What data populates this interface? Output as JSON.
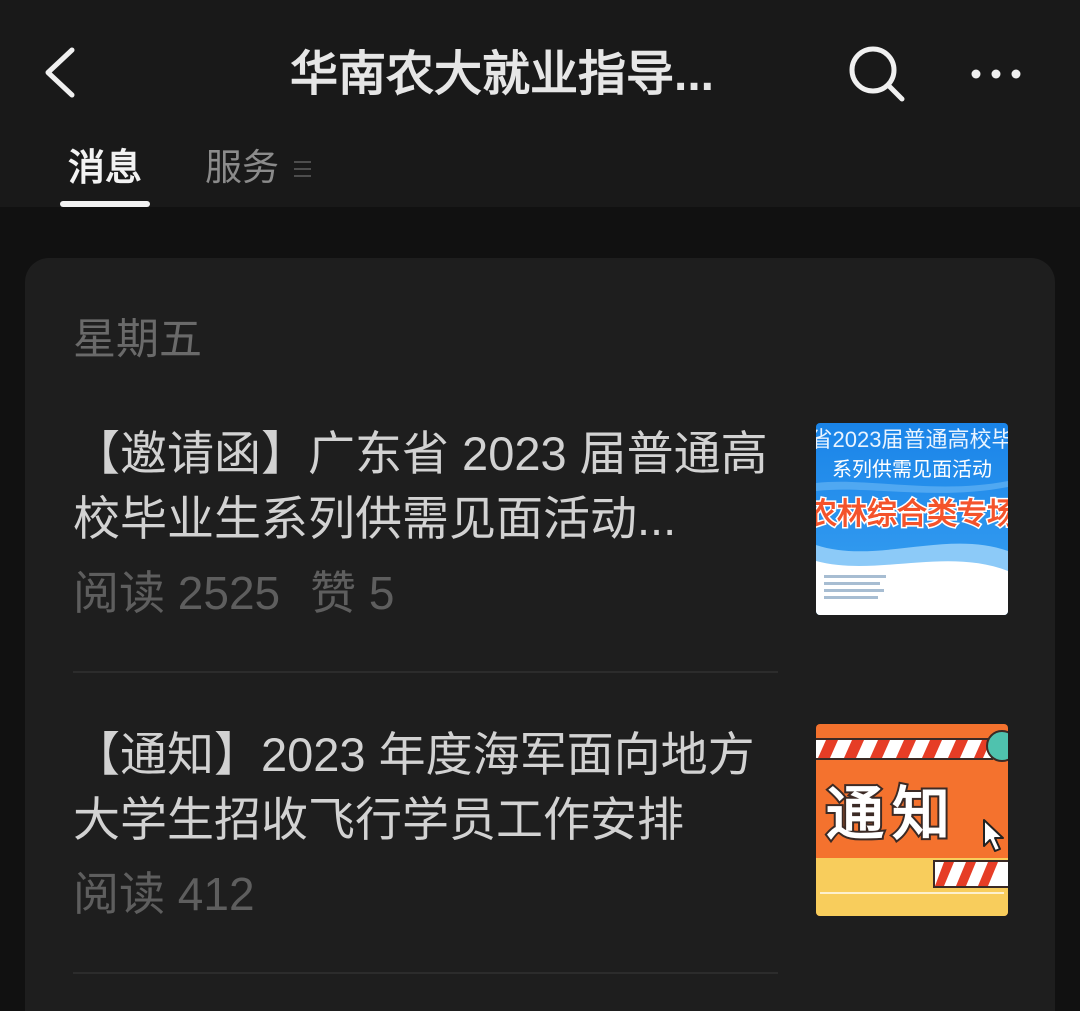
{
  "colors": {
    "page_bg": "#111111",
    "header_bg": "#191919",
    "card_bg": "#1e1e1e",
    "primary_text": "#d2d2d2",
    "secondary_text": "#5e5e5e",
    "divider": "#2c2c2c",
    "tab_active": "#f2f2f2",
    "tab_inactive": "#8b8b8b"
  },
  "header": {
    "back_icon": "chevron-left-icon",
    "title": "华南农大就业指导...",
    "search_icon": "search-icon",
    "more_icon": "more-horizontal-icon"
  },
  "tabs": [
    {
      "label": "消息",
      "active": true
    },
    {
      "label": "服务",
      "active": false,
      "icon": "menu-icon"
    }
  ],
  "feed": {
    "date_label": "星期五",
    "articles": [
      {
        "title": "【邀请函】广东省 2023 届普通高校毕业生系列供需见面活动...",
        "stats": [
          {
            "label": "阅读",
            "value": "2525"
          },
          {
            "label": "赞",
            "value": "5"
          }
        ],
        "thumbnail": {
          "dominant_color": "#1a84e8",
          "lines": [
            "省2023届普通高校毕",
            "系列供需见面活动",
            "农林综合类专场"
          ]
        }
      },
      {
        "title": "【通知】2023 年度海军面向地方大学生招收飞行学员工作安排",
        "stats": [
          {
            "label": "阅读",
            "value": "412"
          }
        ],
        "thumbnail": {
          "dominant_color": "#f4722e",
          "text": "通知",
          "icon": "cursor-icon"
        }
      }
    ]
  }
}
